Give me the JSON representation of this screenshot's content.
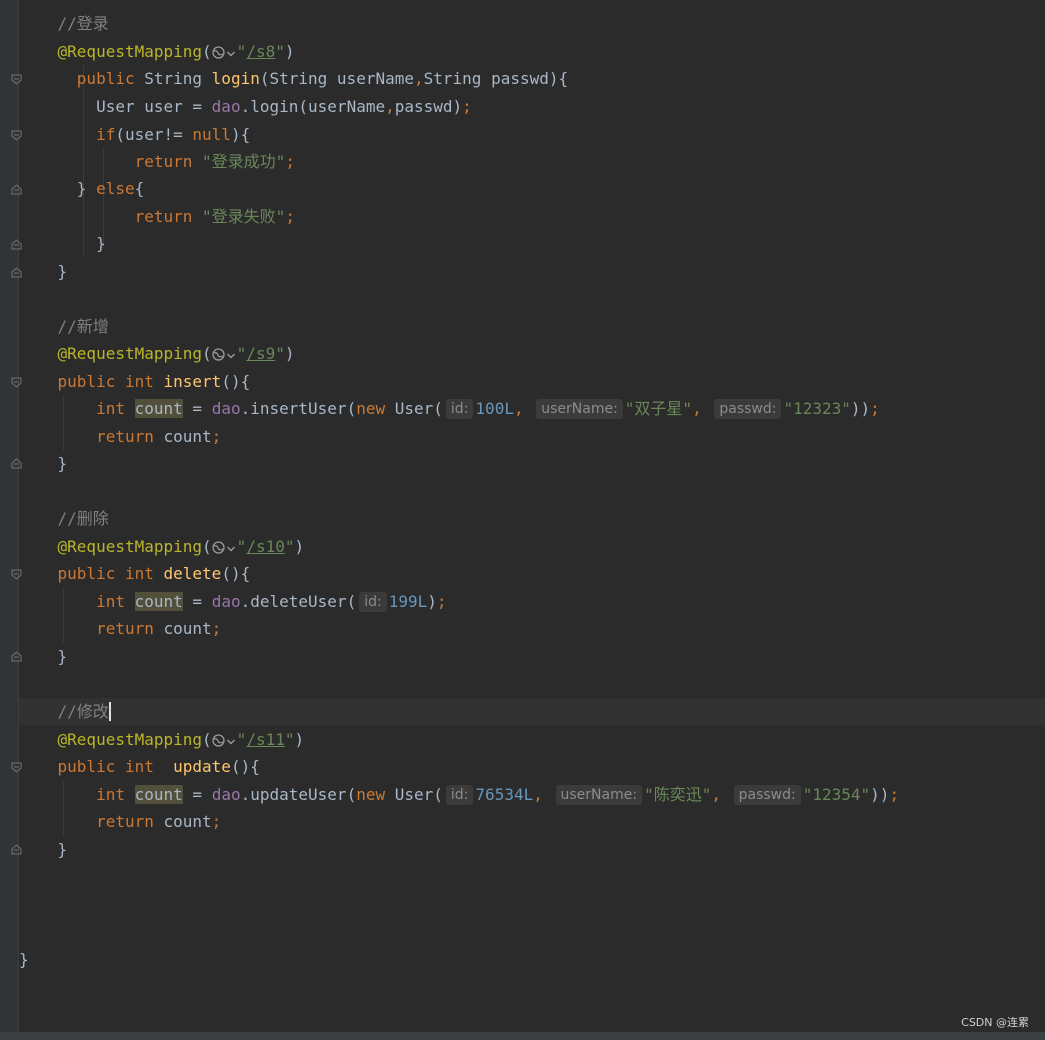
{
  "editor": {
    "comments": {
      "login": "//登录",
      "insert": "//新增",
      "delete": "//删除",
      "update": "//修改"
    },
    "annotation": "@RequestMapping",
    "paths": {
      "login": "/s8",
      "insert": "/s9",
      "delete": "/s10",
      "update": "/s11"
    },
    "keywords": {
      "public": "public",
      "int": "int",
      "return": "return",
      "if": "if",
      "null": "null",
      "else": "else",
      "new": "new"
    },
    "types": {
      "string": "String",
      "user": "User"
    },
    "methods": {
      "login": "login",
      "insert": "insert",
      "delete": "delete",
      "update": "update"
    },
    "dao_calls": {
      "login": "login",
      "insertUser": "insertUser",
      "deleteUser": "deleteUser",
      "updateUser": "updateUser"
    },
    "identifiers": {
      "dao": "dao",
      "user": "user",
      "userName": "userName",
      "passwd": "passwd",
      "count": "count"
    },
    "strings": {
      "success": "\"登录成功\"",
      "fail": "\"登录失败\""
    },
    "param_hints": {
      "id": "id:",
      "userName": "userName:",
      "passwd": "passwd:"
    },
    "insert_args": {
      "id": "100L",
      "userName": "\"双子星\"",
      "passwd": "\"12323\""
    },
    "delete_args": {
      "id": "199L"
    },
    "update_args": {
      "id": "76534L",
      "userName": "\"陈奕迅\"",
      "passwd": "\"12354\""
    }
  },
  "icons": {
    "globe": "globe-icon",
    "chevron": "chevron-down-icon",
    "fold": "fold-marker-icon"
  },
  "colors": {
    "background": "#2b2b2b",
    "keyword": "#cc7832",
    "annotation": "#bbb529",
    "string": "#6a8759",
    "number": "#6897bb",
    "comment": "#808080",
    "method": "#ffc66d",
    "field": "#9876aa"
  },
  "watermark": "CSDN @连累"
}
